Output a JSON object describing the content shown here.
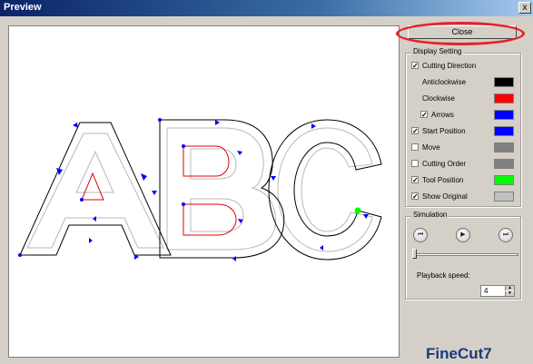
{
  "window": {
    "title": "Preview",
    "close_glyph": "x"
  },
  "close_button": {
    "label": "Close"
  },
  "display_setting": {
    "title": "Display Setting",
    "items": [
      {
        "label": "Cutting Direction",
        "checked": true,
        "has_checkbox": true,
        "color": null
      },
      {
        "label": "Anticlockwise",
        "checked": null,
        "has_checkbox": false,
        "color": "#000000"
      },
      {
        "label": "Clockwise",
        "checked": null,
        "has_checkbox": false,
        "color": "#ff0000"
      },
      {
        "label": "Arrows",
        "checked": true,
        "has_checkbox": true,
        "color": "#0000ff",
        "indent": true
      },
      {
        "label": "Start Position",
        "checked": true,
        "has_checkbox": true,
        "color": "#0000ff"
      },
      {
        "label": "Move",
        "checked": false,
        "has_checkbox": true,
        "color": "#808080"
      },
      {
        "label": "Cutting Order",
        "checked": false,
        "has_checkbox": true,
        "color": "#808080"
      },
      {
        "label": "Tool Position",
        "checked": true,
        "has_checkbox": true,
        "color": "#00ff00"
      },
      {
        "label": "Show Original",
        "checked": true,
        "has_checkbox": true,
        "color": "#c0c0c0"
      }
    ]
  },
  "simulation": {
    "title": "Simulation",
    "buttons": [
      {
        "name": "skip-back-icon",
        "glyph": "⏮"
      },
      {
        "name": "play-icon",
        "glyph": "▶"
      },
      {
        "name": "skip-forward-icon",
        "glyph": "⏭"
      }
    ],
    "slider_position": 0.0,
    "playback_speed_label": "Playback speed:",
    "playback_speed_value": "4"
  },
  "logo": {
    "text": "FineCut7"
  },
  "colors": {
    "cut_path": "#000000",
    "inner_clockwise": "#e00000",
    "original": "#b8b8b8",
    "arrows": "#0000ff",
    "tool_position": "#00ff00",
    "highlight_ring": "#e8202a"
  }
}
